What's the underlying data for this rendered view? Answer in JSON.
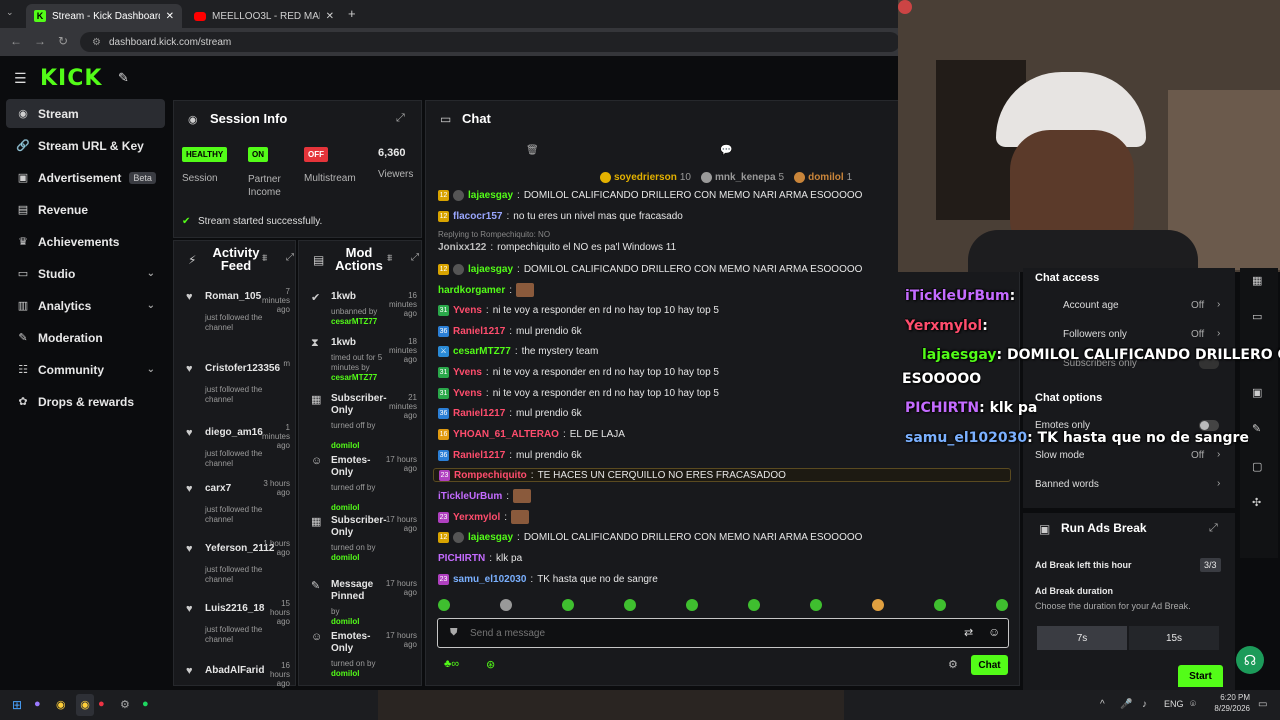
{
  "browser": {
    "tabs": [
      "Stream - Kick Dashboard",
      "MEELLOO3L - RED MALA (VIDE"
    ],
    "url": "dashboard.kick.com/stream"
  },
  "sidebar": {
    "items": [
      {
        "label": "Stream",
        "icon": "record-icon",
        "active": true
      },
      {
        "label": "Stream URL & Key",
        "icon": "link-icon"
      },
      {
        "label": "Advertisement",
        "icon": "ad-icon",
        "badge": "Beta"
      },
      {
        "label": "Revenue",
        "icon": "revenue-icon"
      },
      {
        "label": "Achievements",
        "icon": "trophy-icon"
      },
      {
        "label": "Studio",
        "icon": "studio-icon",
        "expand": true
      },
      {
        "label": "Analytics",
        "icon": "analytics-icon",
        "expand": true
      },
      {
        "label": "Moderation",
        "icon": "wrench-icon"
      },
      {
        "label": "Community",
        "icon": "community-icon",
        "expand": true
      },
      {
        "label": "Drops & rewards",
        "icon": "gift-icon"
      }
    ]
  },
  "session": {
    "title": "Session Info",
    "health_badge": "HEALTHY",
    "health_label": "Session",
    "partner_badge": "ON",
    "partner_label": "Partner Income",
    "multi_badge": "OFF",
    "multi_label": "Multistream",
    "viewers": "6,360",
    "viewers_label": "Viewers",
    "status": "Stream started successfully."
  },
  "activity": {
    "title": "Activity Feed",
    "items": [
      {
        "name": "Roman_105",
        "sub": "just followed the channel",
        "time": "7 minutes ago"
      },
      {
        "name": "Cristofer123356",
        "sub": "just followed the channel",
        "time": "m"
      },
      {
        "name": "diego_am16",
        "sub": "just followed the channel",
        "time": "1 minutes ago"
      },
      {
        "name": "carx7",
        "sub": "just followed the channel",
        "time": "3 hours ago"
      },
      {
        "name": "Yeferson_2112",
        "sub": "just followed the channel",
        "time": "1 hours ago"
      },
      {
        "name": "Luis2216_18",
        "sub": "just followed the channel",
        "time": "15 hours ago"
      },
      {
        "name": "AbadAlFarid",
        "sub": "",
        "time": "16 hours ago"
      }
    ]
  },
  "mod": {
    "title": "Mod Actions",
    "items": [
      {
        "name": "1kwb",
        "time": "16 minutes ago",
        "sub": "unbanned by",
        "by": "cesarMTZ77",
        "icon": "unban-icon"
      },
      {
        "name": "1kwb",
        "time": "18 minutes ago",
        "sub": "timed out for 5 minutes by",
        "by": "cesarMTZ77",
        "icon": "timeout-icon"
      },
      {
        "name": "Subscriber-Only",
        "time": "21 minutes ago",
        "sub": "turned off by",
        "by": "domilol",
        "icon": "calendar-icon"
      },
      {
        "name": "Emotes-Only",
        "time": "17 hours ago",
        "sub": "turned off by",
        "by": "domilol",
        "icon": "emote-icon"
      },
      {
        "name": "Subscriber-Only",
        "time": "17 hours ago",
        "sub": "turned on by",
        "by": "domilol",
        "icon": "calendar-icon"
      },
      {
        "name": "Message Pinned",
        "time": "17 hours ago",
        "sub": "by",
        "by": "domilol",
        "icon": "pin-icon"
      },
      {
        "name": "Emotes-Only",
        "time": "17 hours ago",
        "sub": "turned on by",
        "by": "domilol",
        "icon": "emote-icon"
      }
    ]
  },
  "chat": {
    "title": "Chat",
    "gifters": [
      {
        "name": "soyedrierson",
        "count": "10"
      },
      {
        "name": "mnk_kenepa",
        "count": "5"
      },
      {
        "name": "domilol",
        "count": "1"
      }
    ],
    "messages": [
      {
        "user": "lajaesgay",
        "text": "DOMILOL CALIFICANDO DRILLERO CON MEMO NARI ARMA ESOOOOO",
        "color": "#53fc18",
        "badge": "12"
      },
      {
        "user": "flacocr157",
        "text": "no tu eres un nivel mas que fracasado",
        "color": "#9aa7ff",
        "badge": "12"
      },
      {
        "user": "Jonixx122",
        "text": "rompechiquito el NO es pa'l Windows 11",
        "color": "#bdbdbd",
        "reply": "Replying to Rompechiquito: NO"
      },
      {
        "user": "lajaesgay",
        "text": "DOMILOL CALIFICANDO DRILLERO CON MEMO NARI ARMA ESOOOOO",
        "color": "#53fc18",
        "badge": "12"
      },
      {
        "user": "hardkorgamer",
        "text": "",
        "color": "#53fc18"
      },
      {
        "user": "Yvens",
        "text": "ni te voy a responder en rd no hay top 10 hay top 5",
        "color": "#ff4d6d",
        "badge": "31"
      },
      {
        "user": "Raniel1217",
        "text": "mul prendio 6k",
        "color": "#ff4d6d",
        "badge": "36"
      },
      {
        "user": "cesarMTZ77",
        "text": "the mystery team",
        "color": "#53fc18",
        "badge": ""
      },
      {
        "user": "Yvens",
        "text": "ni te voy a responder en rd no hay top 10 hay top 5",
        "color": "#ff4d6d",
        "badge": "31"
      },
      {
        "user": "Yvens",
        "text": "ni te voy a responder en rd no hay top 10 hay top 5",
        "color": "#ff4d6d",
        "badge": "31"
      },
      {
        "user": "Raniel1217",
        "text": "mul prendio 6k",
        "color": "#ff4d6d",
        "badge": "36"
      },
      {
        "user": "YHOAN_61_ALTERAO",
        "text": "EL DE LAJA",
        "color": "#ff4d6d",
        "badge": "16"
      },
      {
        "user": "Raniel1217",
        "text": "mul prendio 6k",
        "color": "#ff4d6d",
        "badge": "36"
      },
      {
        "user": "Rompechiquito",
        "text": "TE HACES UN CERQUILLO NO ERES FRACASADOO",
        "color": "#ff4d6d",
        "badge": "23"
      },
      {
        "user": "iTickleUrBum",
        "text": "",
        "color": "#c46bff"
      },
      {
        "user": "Yerxmylol",
        "text": "",
        "color": "#ff4d6d",
        "badge": "23"
      },
      {
        "user": "lajaesgay",
        "text": "DOMILOL CALIFICANDO DRILLERO CON MEMO NARI ARMA ESOOOOO",
        "color": "#53fc18",
        "badge": "12"
      },
      {
        "user": "PICHIRTN",
        "text": "klk pa",
        "color": "#c46bff"
      },
      {
        "user": "samu_el102030",
        "text": "TK hasta que no de sangre",
        "color": "#7ab0ff",
        "badge": "23"
      }
    ],
    "input_placeholder": "Send a message",
    "send_label": "Chat"
  },
  "chat_settings": {
    "chat_access_title": "Chat access",
    "account_age": "Account age",
    "account_age_value": "Off",
    "followers_only": "Followers only",
    "followers_only_value": "Off",
    "subscribers_only": "Subscribers only",
    "chat_options_title": "Chat options",
    "emotes_only": "Emotes only",
    "slow_mode": "Slow mode",
    "slow_mode_value": "Off",
    "banned_words": "Banned words"
  },
  "ads": {
    "title": "Run Ads Break",
    "left_label": "Ad Break left this hour",
    "left_value": "3/3",
    "duration_title": "Ad Break duration",
    "duration_sub": "Choose the duration for your Ad Break.",
    "options": [
      "7s",
      "15s"
    ],
    "start_label": "Start"
  },
  "overlay": {
    "lines": [
      {
        "user": "iTickleUrBum",
        "text": ":",
        "color": "#c46bff"
      },
      {
        "user": "Yerxmylol",
        "text": ":",
        "color": "#ff4d6d"
      },
      {
        "user": "lajaesgay",
        "text": ": DOMILOL CALIFICANDO DRILLERO CO",
        "color": "#53fc18"
      },
      {
        "user": "",
        "text": "ESOOOOO",
        "color": "#ffffff"
      },
      {
        "user": "PICHIRTN",
        "text": ": klk pa",
        "color": "#c46bff"
      },
      {
        "user": "samu_el102030",
        "text": ": TK hasta que no de sangre",
        "color": "#7ab0ff"
      }
    ]
  },
  "taskbar": {
    "lang": "ENG",
    "time": "6:20 PM",
    "date": "8/29/2026"
  }
}
